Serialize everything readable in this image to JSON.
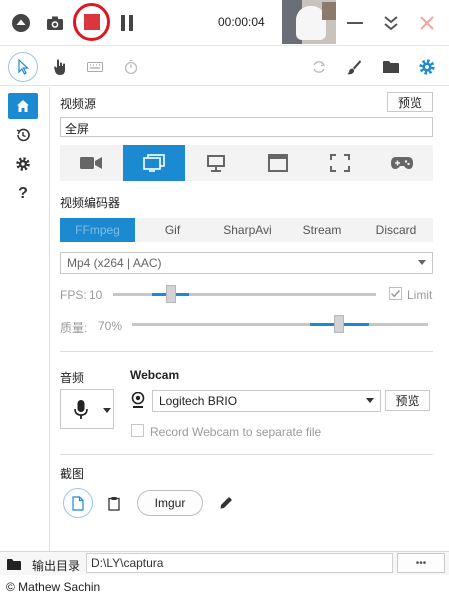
{
  "toolbar": {
    "timer": "00:00:04",
    "icons": [
      "eject-icon",
      "camera-icon",
      "stop-icon",
      "pause-icon",
      "minimize-icon",
      "collapse-icon",
      "close-icon"
    ],
    "stop_highlight_color": "#e0161f",
    "close_color": "#f3a4a4"
  },
  "tools": [
    "cursor-icon",
    "hand-icon",
    "keyboard-icon",
    "timer-icon",
    "refresh-icon",
    "brush-icon",
    "folder-icon",
    "gear-icon"
  ],
  "nav": [
    "home-icon",
    "history-icon",
    "settings-icon",
    "help-icon"
  ],
  "nav_help_label": "?",
  "video_source": {
    "heading": "视频源",
    "preview_label": "预览",
    "value": "全屏",
    "selected_index": 1,
    "sources": [
      "camera-icon",
      "screen-icon",
      "monitor-icon",
      "window-icon",
      "region-icon",
      "gamepad-icon"
    ]
  },
  "encoder": {
    "heading": "视频编码器",
    "tabs": [
      "FFmpeg",
      "Gif",
      "SharpAvi",
      "Stream",
      "Discard"
    ],
    "selected_tab": 0,
    "format": "Mp4 (x264 | AAC)",
    "fps_label": "FPS:",
    "fps_value": "10",
    "fps_level": 0.22,
    "limit_label": "Limit",
    "limit_checked": true,
    "quality_label": "质量:",
    "quality_value": "70%",
    "quality_level": 0.7
  },
  "audio": {
    "heading": "音频",
    "webcam_heading": "Webcam",
    "webcam_device": "Logitech BRIO",
    "preview_label": "预览",
    "record_separate_label": "Record Webcam to separate file"
  },
  "screenshot": {
    "heading": "截图",
    "imgur_label": "Imgur"
  },
  "status": {
    "output_label": "输出目录",
    "output_path": "D:\\LY\\captura",
    "more_label": "•••"
  },
  "footer": {
    "copyright": "© Mathew Sachin"
  },
  "colors": {
    "accent": "#1b8ad1"
  }
}
